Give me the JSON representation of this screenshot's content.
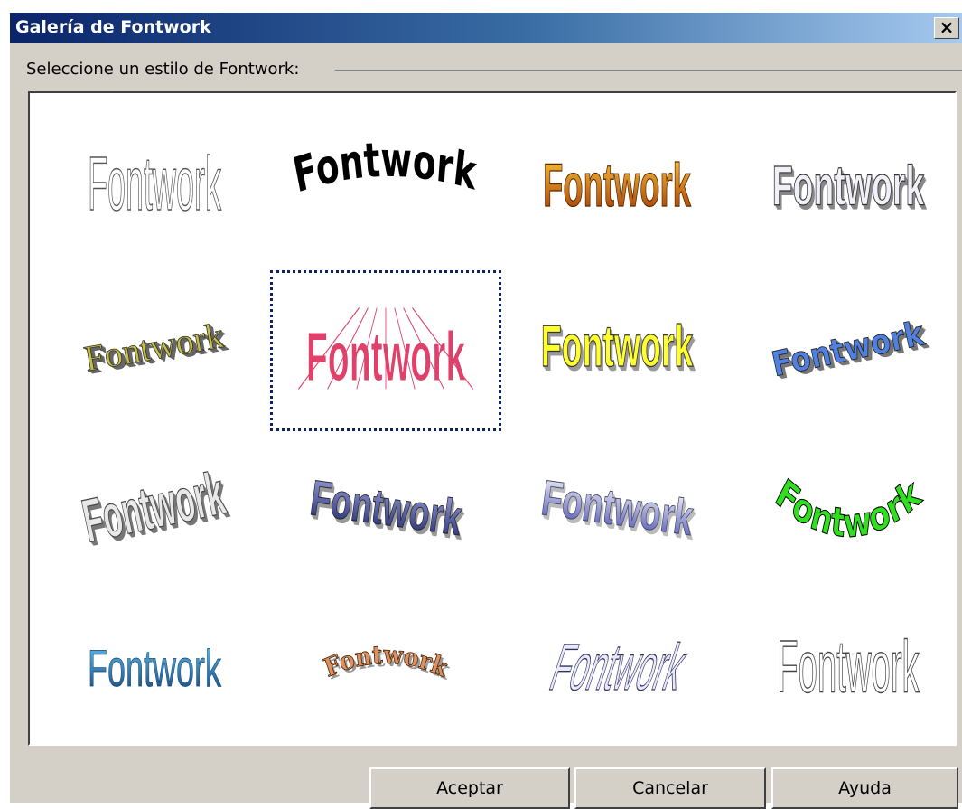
{
  "window": {
    "title": "Galería de Fontwork",
    "close_glyph": "×"
  },
  "group": {
    "label": "Seleccione un estilo de Fontwork:"
  },
  "gallery": {
    "selected_index": 5,
    "items": [
      {
        "text": "Fontwork",
        "style": "outline-tall"
      },
      {
        "text": "Fontwork",
        "style": "black-arch"
      },
      {
        "text": "Fontwork",
        "style": "orange-gradient"
      },
      {
        "text": "Fontwork",
        "style": "silver-3d"
      },
      {
        "text": "Fontwork",
        "style": "olive-serif-slant"
      },
      {
        "text": "Fontwork",
        "style": "pink-perspective"
      },
      {
        "text": "Fontwork",
        "style": "yellow-3d"
      },
      {
        "text": "Fontwork",
        "style": "blue-3d-slant"
      },
      {
        "text": "Fontwork",
        "style": "grey-3d"
      },
      {
        "text": "Fontwork",
        "style": "navy-3d-wave"
      },
      {
        "text": "Fontwork",
        "style": "lavender-3d"
      },
      {
        "text": "Fontwork",
        "style": "green-arc"
      },
      {
        "text": "Fontwork",
        "style": "blue-gradient"
      },
      {
        "text": "Fontwork",
        "style": "copper-arc"
      },
      {
        "text": "Fontwork",
        "style": "lavender-outline-slant"
      },
      {
        "text": "Fontwork",
        "style": "white-outline"
      }
    ]
  },
  "buttons": {
    "ok": "Aceptar",
    "cancel": "Cancelar",
    "help_before": "Ay",
    "help_mnemonic": "u",
    "help_after": "da"
  },
  "colors": {
    "title_start": "#0a246a",
    "title_end": "#a6caf0",
    "dialog_bg": "#d4d0c8",
    "selection": "#0a246a"
  }
}
